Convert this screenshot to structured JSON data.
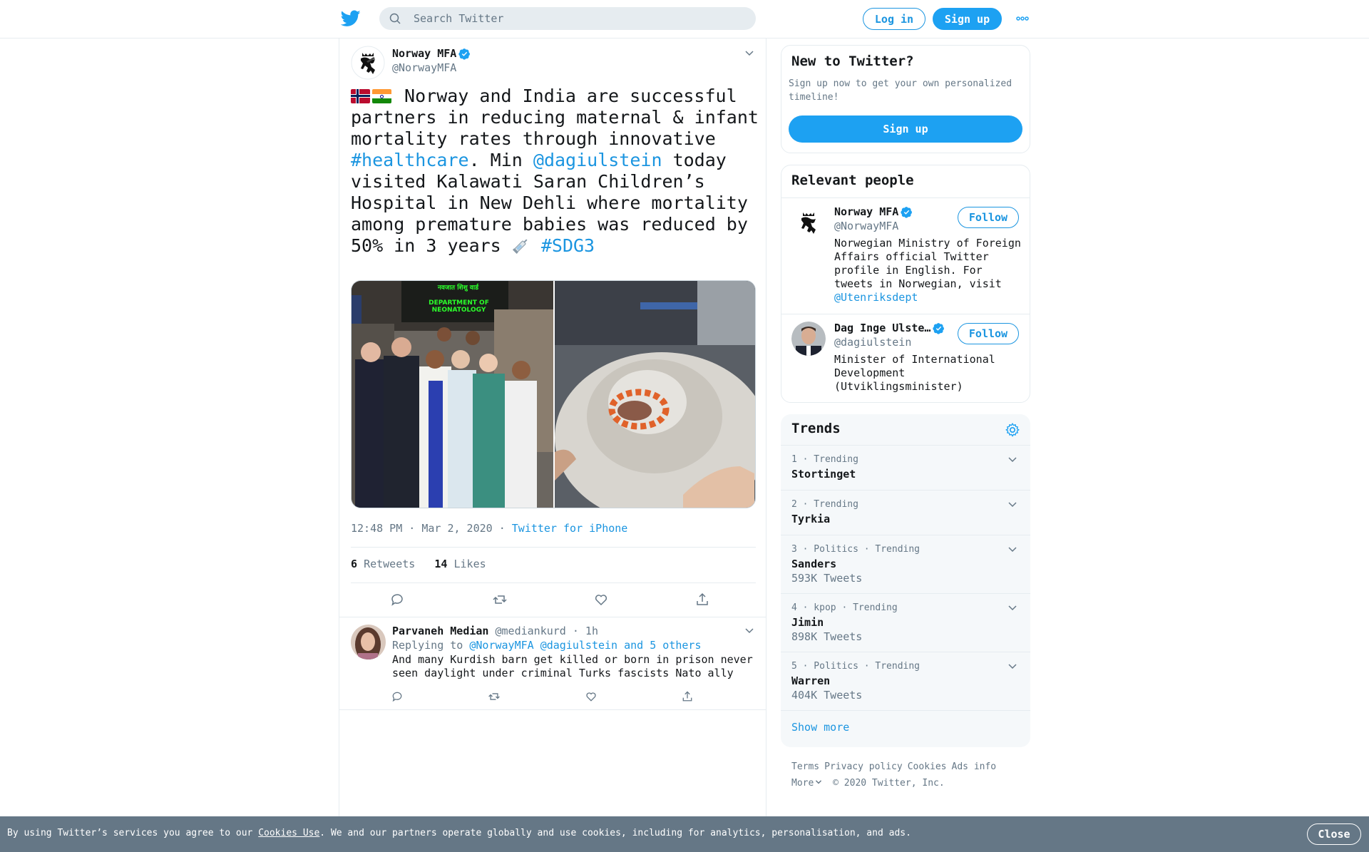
{
  "topbar": {
    "search_placeholder": "Search Twitter",
    "login_label": "Log in",
    "signup_label": "Sign up",
    "more_icon": "more-dots-icon"
  },
  "tweet": {
    "author_name": "Norway MFA",
    "author_handle": "@NorwayMFA",
    "text_intro": " Norway and India are successful partners in reducing maternal & infant mortality rates through innovative ",
    "hashtag_1": "#healthcare",
    "text_mid_1": ". Min ",
    "mention_1": "@dagiulstein",
    "text_mid_2": " today visited Kalawati Saran Children’s Hospital in New Dehli where mortality among premature babies was reduced by 50% in 3 years ",
    "hashtag_2": "#SDG3",
    "timestamp": "12:48 PM · Mar 2, 2020",
    "dot": "·",
    "source": "Twitter for iPhone",
    "retweets_count": "6",
    "retweets_label": "Retweets",
    "likes_count": "14",
    "likes_label": "Likes",
    "photo_sign_text": "DEPARTMENT OF NEONATOLOGY",
    "photo_sign_hindi": "नवजात शिशु वार्ड"
  },
  "reply": {
    "name": "Parvaneh Median",
    "handle": "@mediankurd",
    "time": "· 1h",
    "replying_label": "Replying to",
    "replying_to": "@NorwayMFA @dagiulstein and 5 others",
    "text": "And many Kurdish barn get killed or born in prison never seen daylight under criminal Turks fascists Nato ally"
  },
  "new_to_twitter": {
    "title": "New to Twitter?",
    "subtitle": "Sign up now to get your own personalized timeline!",
    "button": "Sign up"
  },
  "relevant_people": {
    "title": "Relevant people",
    "people": [
      {
        "name": "Norway MFA",
        "handle": "@NorwayMFA",
        "bio": "Norwegian Ministry of Foreign Affairs official Twitter profile in English. For tweets in Norwegian, visit ",
        "bio_link": "@Utenriksdept",
        "follow": "Follow"
      },
      {
        "name": "Dag Inge Ulste…",
        "handle": "@dagiulstein",
        "bio": "Minister of International Development (Utviklingsminister)",
        "follow": "Follow"
      }
    ]
  },
  "trends": {
    "title": "Trends",
    "items": [
      {
        "meta": "1 · Trending",
        "name": "Stortinget",
        "count": ""
      },
      {
        "meta": "2 · Trending",
        "name": "Tyrkia",
        "count": ""
      },
      {
        "meta": "3 · Politics · Trending",
        "name": "Sanders",
        "count": "593K Tweets"
      },
      {
        "meta": "4 · kpop · Trending",
        "name": "Jimin",
        "count": "898K Tweets"
      },
      {
        "meta": "5 · Politics · Trending",
        "name": "Warren",
        "count": "404K Tweets"
      }
    ],
    "show_more": "Show more"
  },
  "footer": {
    "terms": "Terms",
    "privacy": "Privacy policy",
    "cookies": "Cookies",
    "ads": "Ads info",
    "more": "More",
    "copyright": "© 2020 Twitter, Inc."
  },
  "cookie_bar": {
    "text_before": "By using Twitter’s services you agree to our ",
    "link": "Cookies Use",
    "text_after": ". We and our partners operate globally and use cookies, including for analytics, personalisation, and ads.",
    "close": "Close"
  },
  "colors": {
    "brand": "#1da1f2",
    "link": "#1b95e0",
    "muted": "#657786",
    "border": "#e6ecf0"
  }
}
